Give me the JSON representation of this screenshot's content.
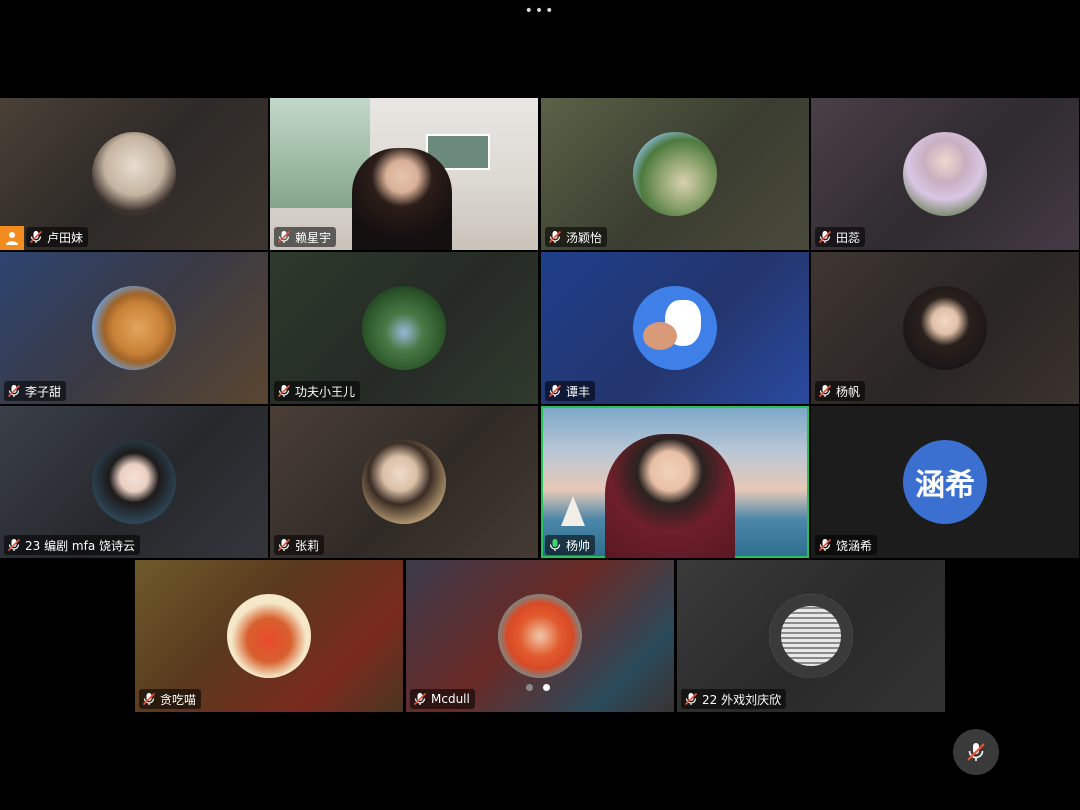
{
  "colors": {
    "background": "#000000",
    "active_speaker_border": "#27c25a",
    "host_badge": "#f28c1e",
    "muted_mic": "#e5533d",
    "active_mic": "#3fd46a"
  },
  "top_bar": {
    "more_icon": "more-icon"
  },
  "participants": [
    {
      "name": "卢田妹",
      "mic": "muted",
      "host": true
    },
    {
      "name": "赖星宇",
      "mic": "muted"
    },
    {
      "name": "汤颖怡",
      "mic": "muted"
    },
    {
      "name": "田蕊",
      "mic": "muted"
    },
    {
      "name": "李子甜",
      "mic": "muted"
    },
    {
      "name": "功夫小王儿",
      "mic": "muted"
    },
    {
      "name": "谭丰",
      "mic": "muted"
    },
    {
      "name": "杨帆",
      "mic": "muted"
    },
    {
      "name": "23 编剧 mfa 饶诗云",
      "mic": "muted"
    },
    {
      "name": "张莉",
      "mic": "muted"
    },
    {
      "name": "杨帅",
      "mic": "speaking",
      "active": true
    },
    {
      "name": "饶涵希",
      "mic": "muted",
      "avatar_text": "涵希"
    },
    {
      "name": "贪吃喵",
      "mic": "muted"
    },
    {
      "name": "Mcdull",
      "mic": "muted"
    },
    {
      "name": "22 外戏刘庆欣",
      "mic": "muted"
    }
  ],
  "pagination": {
    "pages": 2,
    "current": 2
  },
  "bottom_controls": {
    "mic_state": "muted"
  }
}
